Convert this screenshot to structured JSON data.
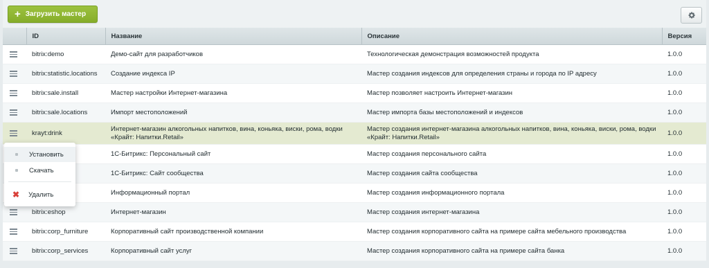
{
  "toolbar": {
    "add_label": "Загрузить мастер",
    "add_icon": "plus-icon",
    "settings_icon": "gear-icon"
  },
  "columns": [
    "ID",
    "Название",
    "Описание",
    "Версия"
  ],
  "rows": [
    {
      "id": "bitrix:demo",
      "name": "Демо-сайт для разработчиков",
      "desc": "Технологическая демонстрация возможностей продукта",
      "version": "1.0.0"
    },
    {
      "id": "bitrix:statistic.locations",
      "name": "Создание индекса IP",
      "desc": "Мастер создания индексов для определения страны и города по IP адресу",
      "version": "1.0.0"
    },
    {
      "id": "bitrix:sale.install",
      "name": "Мастер настройки Интернет-магазина",
      "desc": "Мастер позволяет настроить Интернет-магазин",
      "version": "1.0.0"
    },
    {
      "id": "bitrix:sale.locations",
      "name": "Импорт местоположений",
      "desc": "Мастер импорта базы местоположений и индексов",
      "version": "1.0.0"
    },
    {
      "id": "krayt:drink",
      "name": "Интернет-магазин алкогольных напитков, вина, коньяка, виски, рома, водки «Крайт: Напитки.Retail»",
      "desc": "Мастер создания интернет-магазина алкогольных напитков, вина, коньяка, виски, рома, водки «Крайт: Напитки.Retail»",
      "version": "1.0.0"
    },
    {
      "id": "ersonal",
      "name": "1С-Битрикс: Персональный сайт",
      "desc": "Мастер создания персонального сайта",
      "version": "1.0.0"
    },
    {
      "id": "ommunity",
      "name": "1С-Битрикс: Сайт сообщества",
      "desc": "Мастер создания сайта сообщества",
      "version": "1.0.0"
    },
    {
      "id": "al",
      "name": "Информационный портал",
      "desc": "Мастер создания информационного портала",
      "version": "1.0.0"
    },
    {
      "id": "bitrix:eshop",
      "name": "Интернет-магазин",
      "desc": "Мастер создания интернет-магазина",
      "version": "1.0.0"
    },
    {
      "id": "bitrix:corp_furniture",
      "name": "Корпоративный сайт производственной компании",
      "desc": "Мастер создания корпоративного сайта на примере сайта мебельного производства",
      "version": "1.0.0"
    },
    {
      "id": "bitrix:corp_services",
      "name": "Корпоративный сайт услуг",
      "desc": "Мастер создания корпоративного сайта на примере сайта банка",
      "version": "1.0.0"
    }
  ],
  "context_menu": {
    "install": "Установить",
    "download": "Скачать",
    "delete": "Удалить"
  },
  "colors": {
    "accent_green": "#8cb533",
    "selected_row": "#e4ead1",
    "delete_red": "#d9413a"
  }
}
